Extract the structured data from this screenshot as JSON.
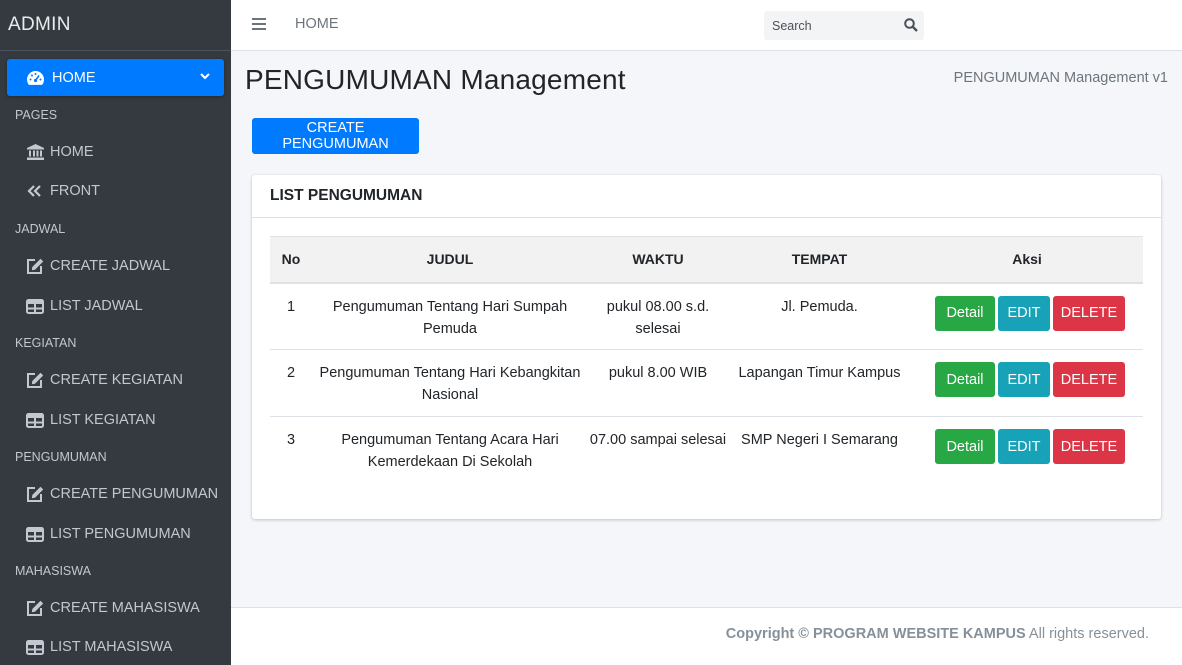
{
  "sidebar": {
    "brand": "ADMIN",
    "active_item": {
      "label": "HOME",
      "icon": "dashboard-icon"
    },
    "sections": {
      "pages": "PAGES",
      "jadwal": "JADWAL",
      "kegiatan": "KEGIATAN",
      "pengumuman": "PENGUMUMAN",
      "mahasiswa": "MAHASISWA"
    },
    "items": {
      "home": "HOME",
      "front": "FRONT",
      "create_jadwal": "CREATE JADWAL",
      "list_jadwal": "LIST JADWAL",
      "create_kegiatan": "CREATE KEGIATAN",
      "list_kegiatan": "LIST KEGIATAN",
      "create_pengumuman": "CREATE PENGUMUMAN",
      "list_pengumuman": "LIST PENGUMUMAN",
      "create_mahasiswa": "CREATE MAHASISWA",
      "list_mahasiswa": "LIST MAHASISWA"
    }
  },
  "topbar": {
    "home_link": "HOME",
    "search_placeholder": "Search"
  },
  "content": {
    "title": "PENGUMUMAN Management",
    "version": "PENGUMUMAN Management v1",
    "create_button": "CREATE PENGUMUMAN"
  },
  "card": {
    "title": "LIST PENGUMUMAN",
    "columns": [
      "No",
      "JUDUL",
      "WAKTU",
      "TEMPAT",
      "Aksi"
    ],
    "rows": [
      {
        "no": "1",
        "judul": "Pengumuman Tentang Hari Sumpah Pemuda",
        "waktu": "pukul 08.00 s.d. selesai",
        "tempat": "Jl. Pemuda."
      },
      {
        "no": "2",
        "judul": "Pengumuman Tentang Hari Kebangkitan Nasional",
        "waktu": "pukul 8.00 WIB",
        "tempat": "Lapangan Timur Kampus"
      },
      {
        "no": "3",
        "judul": "Pengumuman Tentang Acara Hari Kemerdekaan Di Sekolah",
        "waktu": "07.00 sampai selesai",
        "tempat": "SMP Negeri I Semarang"
      }
    ],
    "actions": {
      "detail": "Detail",
      "edit": "EDIT",
      "delete": "DELETE"
    }
  },
  "footer": {
    "copyright": "Copyright © PROGRAM WEBSITE KAMPUS",
    "rights": "All rights reserved."
  },
  "colors": {
    "sidebar_bg": "#343a40",
    "primary": "#007bff",
    "success": "#28a745",
    "info": "#17a2b8",
    "danger": "#dc3545"
  }
}
